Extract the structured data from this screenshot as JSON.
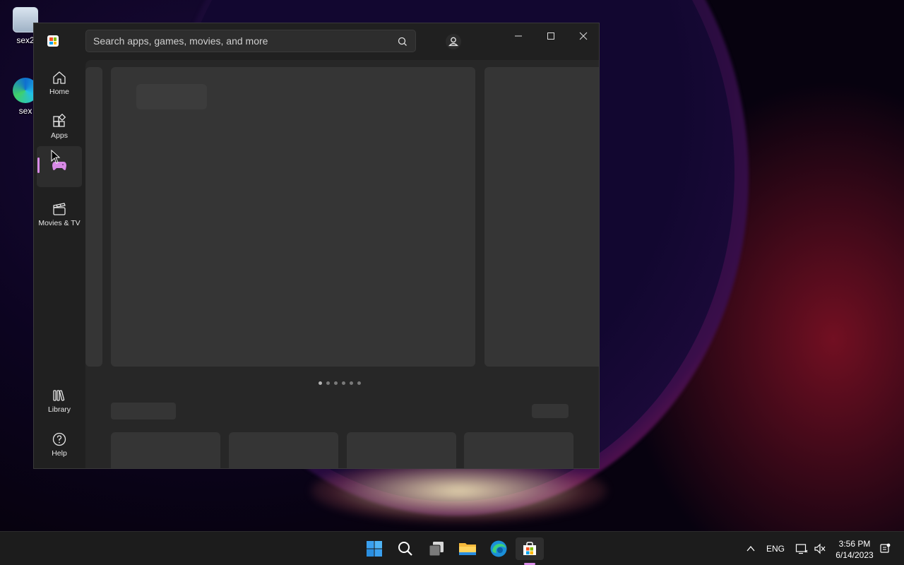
{
  "desktop": {
    "icons": [
      {
        "label": "sex2"
      },
      {
        "label": "sex"
      }
    ]
  },
  "store": {
    "search_placeholder": "Search apps, games, movies, and more",
    "nav": [
      {
        "label": "Home",
        "icon": "home-icon"
      },
      {
        "label": "Apps",
        "icon": "apps-icon"
      },
      {
        "label": "",
        "icon": "gamepad-icon",
        "active": true
      },
      {
        "label": "Movies & TV",
        "icon": "clapperboard-icon"
      },
      {
        "label": "Library",
        "icon": "library-icon"
      },
      {
        "label": "Help",
        "icon": "help-icon"
      }
    ],
    "carousel_pages": 6,
    "carousel_active_page": 1,
    "accent_color": "#d88ae6"
  },
  "taskbar": {
    "apps": [
      "start-icon",
      "search-icon",
      "task-view-icon",
      "file-explorer-icon",
      "edge-icon",
      "store-icon"
    ],
    "language": "ENG",
    "time": "3:56 PM",
    "date": "6/14/2023"
  }
}
